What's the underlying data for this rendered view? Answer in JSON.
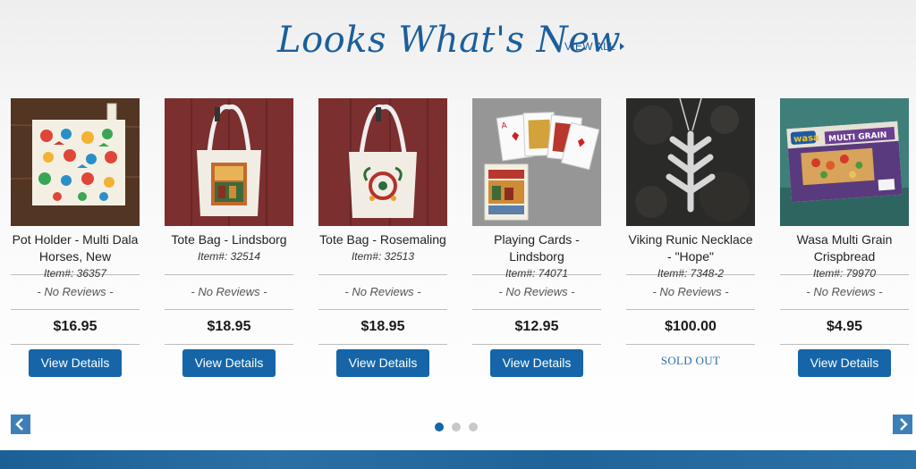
{
  "section": {
    "title": "Looks What's New",
    "view_all": "VIEW ALL"
  },
  "products": [
    {
      "name": "Pot Holder - Multi Dala Horses, New",
      "item_num": "Item#: 36357",
      "reviews": "- No Reviews -",
      "price": "$16.95",
      "action": "View Details",
      "image": "pot-holder-dala-horses-image"
    },
    {
      "name": "Tote Bag - Lindsborg",
      "item_num": "Item#: 32514",
      "reviews": "- No Reviews -",
      "price": "$18.95",
      "action": "View Details",
      "image": "tote-bag-lindsborg-image"
    },
    {
      "name": "Tote Bag - Rosemaling",
      "item_num": "Item#: 32513",
      "reviews": "- No Reviews -",
      "price": "$18.95",
      "action": "View Details",
      "image": "tote-bag-rosemaling-image"
    },
    {
      "name": "Playing Cards - Lindsborg",
      "item_num": "Item#: 74071",
      "reviews": "- No Reviews -",
      "price": "$12.95",
      "action": "View Details",
      "image": "playing-cards-image"
    },
    {
      "name": "Viking Runic Necklace - \"Hope\"",
      "item_num": "Item#: 7348-2",
      "reviews": "- No Reviews -",
      "price": "$100.00",
      "status": "SOLD OUT",
      "image": "runic-necklace-image"
    },
    {
      "name": "Wasa Multi Grain Crispbread",
      "item_num": "Item#: 79970",
      "reviews": "- No Reviews -",
      "price": "$4.95",
      "action": "View Details",
      "image": "wasa-crispbread-image"
    }
  ],
  "box_label": {
    "brand": "wasa",
    "product": "MULTI GRAIN"
  },
  "carousel": {
    "pages": 3,
    "active_page": 1,
    "prev_icon": "chevron-left-icon",
    "next_icon": "chevron-right-icon"
  },
  "colors": {
    "accent": "#1565a8",
    "title": "#1b5f9c",
    "footer": "#1f6399"
  }
}
